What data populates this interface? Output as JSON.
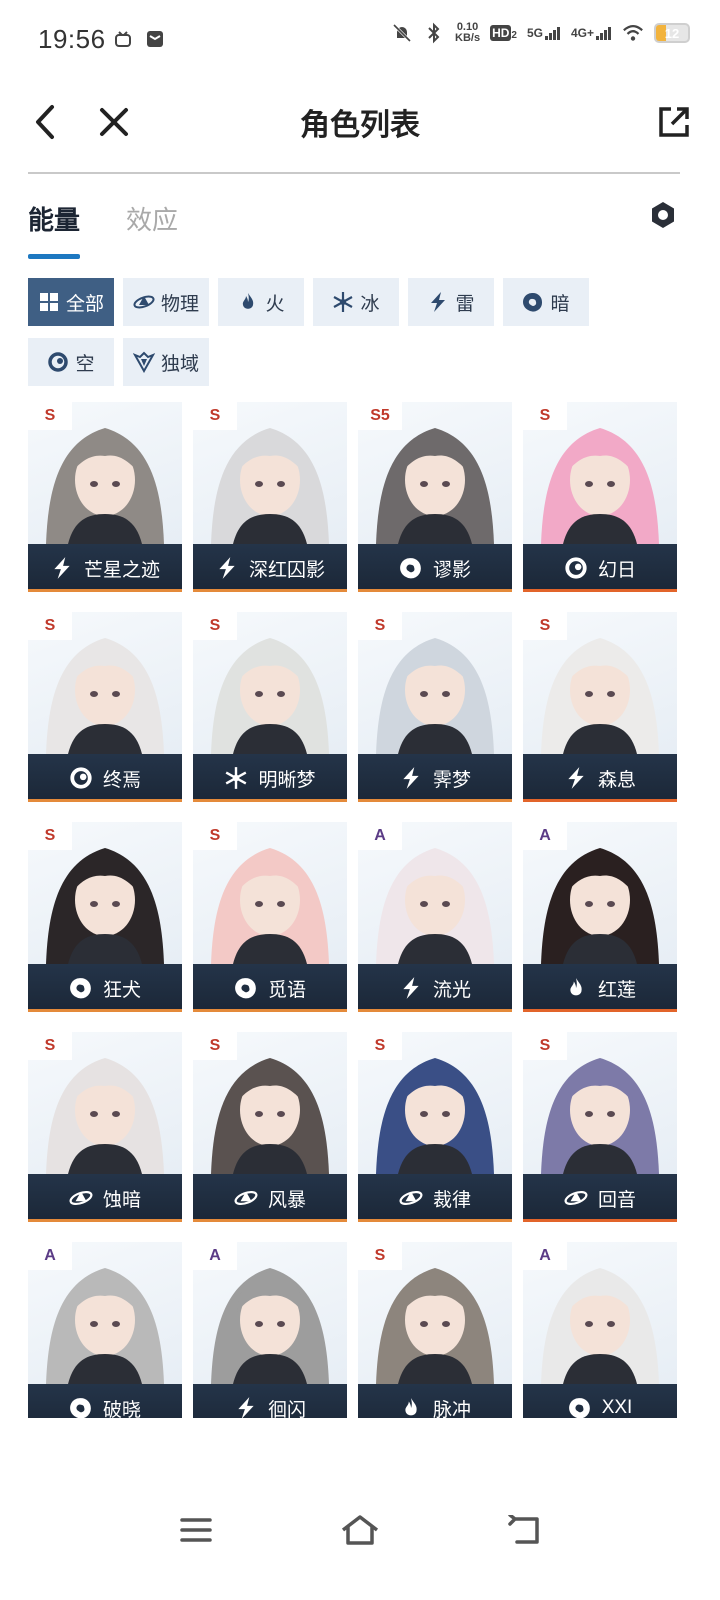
{
  "status_bar": {
    "time": "19:56",
    "net_speed_value": "0.10",
    "net_speed_unit": "KB/s",
    "hd_badge": "HD",
    "hd_sub": "2",
    "signal_5g": "5G",
    "signal_4g": "4G+",
    "battery": "12",
    "colors": {
      "battery_fill": "#f2b33d"
    }
  },
  "header": {
    "title": "角色列表",
    "icons": [
      "back-icon",
      "close-icon",
      "share-icon"
    ]
  },
  "tabs": [
    {
      "label": "能量",
      "active": true
    },
    {
      "label": "效应",
      "active": false
    }
  ],
  "filters": [
    {
      "label": "全部",
      "icon": "grid-icon",
      "active": true
    },
    {
      "label": "物理",
      "icon": "physical-icon",
      "active": false
    },
    {
      "label": "火",
      "icon": "fire-icon",
      "active": false
    },
    {
      "label": "冰",
      "icon": "snowflake-icon",
      "active": false
    },
    {
      "label": "雷",
      "icon": "lightning-icon",
      "active": false
    },
    {
      "label": "暗",
      "icon": "dark-swirl-icon",
      "active": false
    },
    {
      "label": "空",
      "icon": "void-ring-icon",
      "active": false
    },
    {
      "label": "独域",
      "icon": "unique-domain-icon",
      "active": false
    }
  ],
  "characters": [
    {
      "name": "芒星之迹",
      "rank": "S",
      "element": "lightning"
    },
    {
      "name": "深红囚影",
      "rank": "S",
      "element": "lightning"
    },
    {
      "name": "谬影",
      "rank": "S5",
      "element": "dark"
    },
    {
      "name": "幻日",
      "rank": "S",
      "element": "void"
    },
    {
      "name": "终焉",
      "rank": "S",
      "element": "void"
    },
    {
      "name": "明晰梦",
      "rank": "S",
      "element": "ice"
    },
    {
      "name": "霁梦",
      "rank": "S",
      "element": "lightning"
    },
    {
      "name": "森息",
      "rank": "S",
      "element": "lightning"
    },
    {
      "name": "狂犬",
      "rank": "S",
      "element": "dark"
    },
    {
      "name": "觅语",
      "rank": "S",
      "element": "dark"
    },
    {
      "name": "流光",
      "rank": "A",
      "element": "lightning"
    },
    {
      "name": "红莲",
      "rank": "A",
      "element": "fire"
    },
    {
      "name": "蚀暗",
      "rank": "S",
      "element": "physical"
    },
    {
      "name": "风暴",
      "rank": "S",
      "element": "physical"
    },
    {
      "name": "裁律",
      "rank": "S",
      "element": "physical"
    },
    {
      "name": "回音",
      "rank": "S",
      "element": "physical"
    },
    {
      "name": "破晓",
      "rank": "A",
      "element": "dark"
    },
    {
      "name": "徊闪",
      "rank": "A",
      "element": "lightning"
    },
    {
      "name": "脉冲",
      "rank": "S",
      "element": "fire"
    },
    {
      "name": "XXI",
      "rank": "A",
      "element": "dark"
    }
  ],
  "colors": {
    "active_tab_underline": "#1d78c1",
    "active_chip": "#3f5f84",
    "chip_bg": "#e9eff6",
    "namebar": "#1b2737",
    "rank_s": "#c0392b",
    "rank_a": "#5b3b86",
    "accent_line": "#e2642a"
  },
  "nav_bar": {
    "icons": [
      "menu-icon",
      "home-icon",
      "back-nav-icon"
    ]
  }
}
